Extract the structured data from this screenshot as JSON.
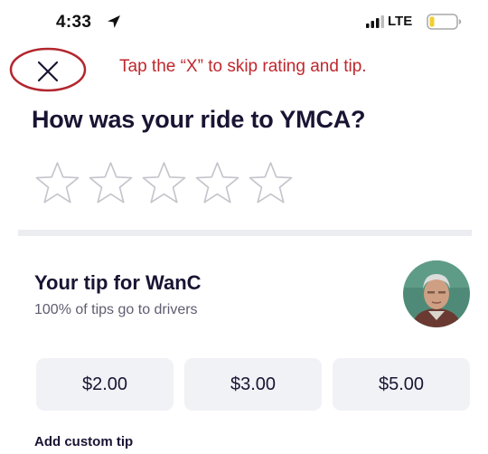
{
  "status_bar": {
    "time": "4:33",
    "network": "LTE",
    "icons": [
      "location-arrow-icon",
      "signal-bars-icon",
      "battery-icon"
    ]
  },
  "annotation": {
    "text": "Tap the “X” to skip rating and tip.",
    "color": "#c0272d"
  },
  "rating": {
    "question": "How was your ride to YMCA?",
    "star_count": 5,
    "selected": 0
  },
  "tip": {
    "heading": "Your tip for WanC",
    "subtitle": "100% of tips go to drivers",
    "options": [
      "$2.00",
      "$3.00",
      "$5.00"
    ],
    "custom_label": "Add custom tip"
  },
  "colors": {
    "text_primary": "#1a1433",
    "text_secondary": "#5f5d70",
    "button_bg": "#f1f2f6",
    "annotation": "#c0272d"
  }
}
